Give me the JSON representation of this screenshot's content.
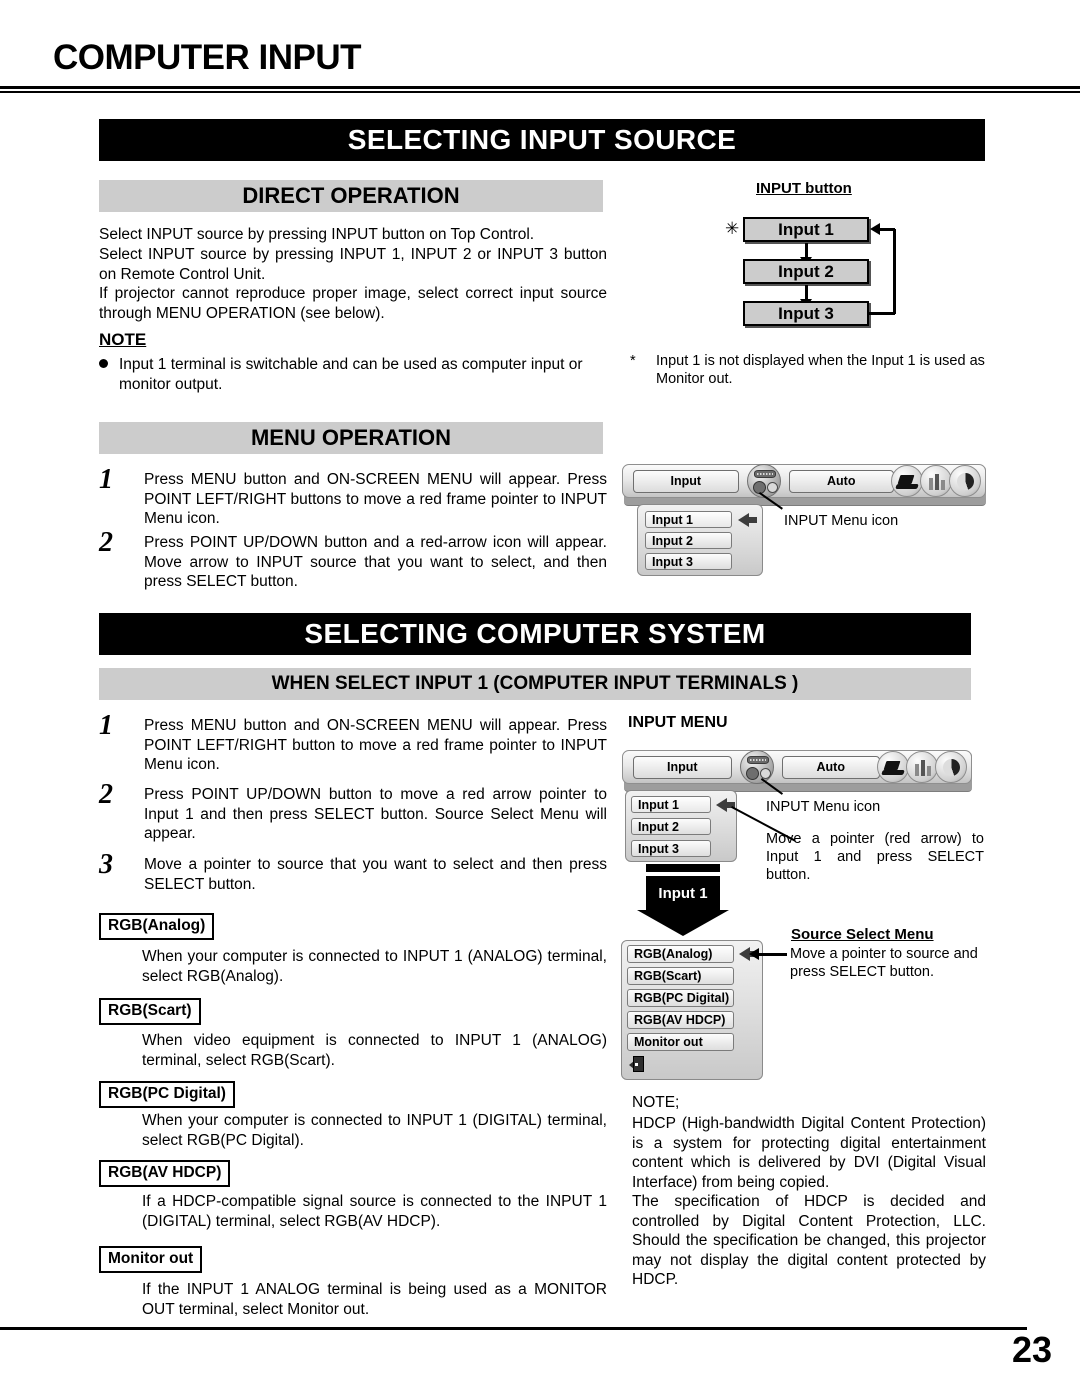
{
  "document": {
    "running_head": "COMPUTER INPUT",
    "page_number": "23"
  },
  "sections": {
    "selecting_input_source": {
      "banner": "SELECTING INPUT SOURCE",
      "direct_operation": {
        "banner": "DIRECT OPERATION",
        "paragraphs": [
          "Select INPUT source by pressing INPUT button on Top Control.",
          "Select INPUT source by pressing INPUT 1, INPUT 2 or INPUT 3 button on Remote Control Unit.",
          "If projector cannot reproduce proper image, select correct input source through MENU OPERATION (see below)."
        ],
        "note_heading": "NOTE",
        "note_bullet": "Input 1 terminal is switchable and can be used as computer input or monitor output."
      },
      "menu_operation": {
        "banner": "MENU OPERATION",
        "steps": [
          {
            "num": "1",
            "text": "Press MENU button and ON-SCREEN MENU will appear.  Press POINT LEFT/RIGHT buttons to move a red frame pointer to INPUT Menu icon."
          },
          {
            "num": "2",
            "text": "Press POINT UP/DOWN button and a red-arrow icon will appear.  Move arrow to INPUT source that you want to select, and then press SELECT button."
          }
        ]
      },
      "input_button_figure": {
        "caption": "INPUT button",
        "asterisk_mark": "✳",
        "boxes": [
          "Input 1",
          "Input 2",
          "Input 3"
        ],
        "footnote": "Input 1 is not displayed when the Input 1 is used as Monitor out."
      },
      "menu_figure": {
        "bar_tabs": [
          "Input",
          "Auto"
        ],
        "items": [
          "Input 1",
          "Input 2",
          "Input 3"
        ],
        "callout": "INPUT Menu icon",
        "icons": [
          "vga-connector-icon",
          "laptop-icon",
          "bars-icon",
          "circle-icon"
        ]
      }
    },
    "selecting_computer_system": {
      "banner": "SELECTING COMPUTER SYSTEM",
      "subbanner": "WHEN SELECT  INPUT 1 (COMPUTER INPUT TERMINALS )",
      "steps": [
        {
          "num": "1",
          "text": "Press MENU button and ON-SCREEN MENU will appear.  Press POINT LEFT/RIGHT button to move a red frame pointer to INPUT Menu icon."
        },
        {
          "num": "2",
          "text": "Press POINT UP/DOWN button to move a red arrow pointer to Input 1 and then press SELECT button.  Source Select Menu will appear."
        },
        {
          "num": "3",
          "text": "Move a pointer to source that you want to select and then press SELECT button."
        }
      ],
      "sources": [
        {
          "label": "RGB(Analog)",
          "desc": "When your computer is connected to INPUT 1 (ANALOG) terminal, select RGB(Analog)."
        },
        {
          "label": "RGB(Scart)",
          "desc": "When video equipment is connected to INPUT 1 (ANALOG) terminal, select RGB(Scart)."
        },
        {
          "label": "RGB(PC Digital)",
          "desc": "When your computer is connected to INPUT 1 (DIGITAL) terminal, select RGB(PC Digital)."
        },
        {
          "label": "RGB(AV HDCP)",
          "desc": "If a HDCP-compatible signal source is connected to the INPUT 1 (DIGITAL) terminal, select RGB(AV HDCP)."
        },
        {
          "label": "Monitor out",
          "desc": "If the INPUT 1 ANALOG terminal is being used as a MONITOR OUT terminal, select Monitor out."
        }
      ],
      "input_menu_figure": {
        "heading": "INPUT MENU",
        "bar_tabs": [
          "Input",
          "Auto"
        ],
        "items": [
          "Input 1",
          "Input 2",
          "Input 3"
        ],
        "callout_icon": "INPUT Menu icon",
        "callout_pointer": "Move a pointer (red arrow) to Input 1 and press SELECT button.",
        "transition_label": "Input 1"
      },
      "source_select_menu": {
        "heading": "Source Select Menu",
        "items": [
          "RGB(Analog)",
          "RGB(Scart)",
          "RGB(PC Digital)",
          "RGB(AV HDCP)",
          "Monitor out"
        ],
        "exit_item": "exit-icon",
        "callout": "Move a pointer to source and press SELECT button."
      },
      "hdcp_note": {
        "heading": "NOTE;",
        "paragraphs": [
          "HDCP (High-bandwidth Digital Content Protection) is a system for protecting digital entertainment content which is delivered by DVI (Digital Visual Interface) from being copied.",
          "The specification of HDCP is decided and controlled by Digital Content Protection, LLC. Should the specification be changed, this projector may not display the digital content protected by HDCP."
        ]
      }
    }
  },
  "colors": {
    "banner_bg": "#000000",
    "banner_fg": "#ffffff",
    "subbanner_bg": "#cccccc",
    "page_bg": "#ffffff",
    "text": "#000000"
  }
}
